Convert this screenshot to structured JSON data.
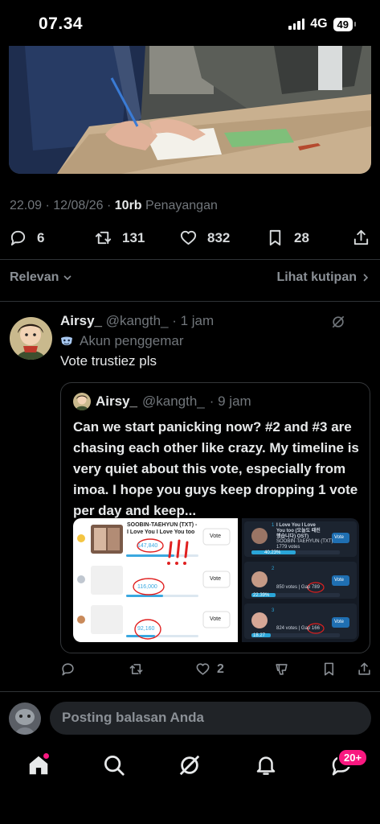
{
  "status": {
    "time": "07.34",
    "network": "4G",
    "battery": "49"
  },
  "post": {
    "meta_time": "22.09 · 12/08/26 · ",
    "views": "10rb",
    "views_label": "Penayangan",
    "replies": "6",
    "reposts": "131",
    "likes": "832",
    "bookmarks": "28"
  },
  "filter": {
    "sort": "Relevan",
    "quotes": "Lihat kutipan"
  },
  "reply": {
    "name": "Airsy_",
    "handle": "@kangth_",
    "time": "· 1 jam",
    "badge": "Akun penggemar",
    "text": "Vote trustiez pls",
    "likes": "2"
  },
  "quote": {
    "name": "Airsy_",
    "handle": "@kangth_",
    "time": "· 9 jam",
    "text": "Can we start panicking now? #2 and #3 are chasing each other like crazy. My timeline is very quiet about this vote, especially from imoa. I hope you guys keep dropping 1 vote per day and keep...",
    "img1": {
      "title": "SOOBIN-TAEHYUN (TXT) - I Love You I Love You too",
      "vote": "Vote",
      "counts": [
        "147,840",
        "116,000",
        "92,160"
      ]
    },
    "img2": {
      "title": "I Love You I Love You too (오늘도 때린했습니다) OST)",
      "artist": "SOOBIN·TAEHYUN (TXT)",
      "votes": "1779 votes",
      "pct1": "40.23%",
      "pct2": "22.39%",
      "pct3": "18.27",
      "r2": "850 votes | Gap 789",
      "r3": "824 votes | Gap 166",
      "ranks": [
        "1",
        "2",
        "3"
      ],
      "vote": "Vote"
    }
  },
  "composer": {
    "placeholder": "Posting balasan Anda"
  },
  "nav": {
    "messages_badge": "20+"
  },
  "colors": {
    "accent": "#1d9bf0",
    "badge": "#f91880",
    "muted": "#71767b"
  }
}
